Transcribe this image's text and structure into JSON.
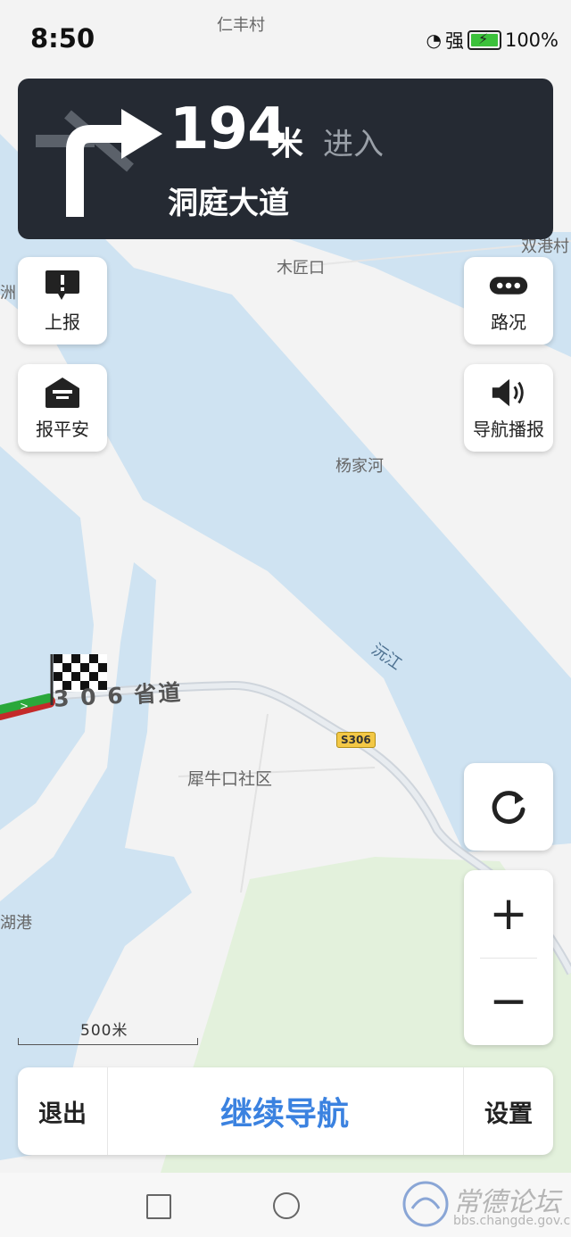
{
  "status_bar": {
    "time": "8:50",
    "signal_label": "强",
    "battery": "100%"
  },
  "nav_card": {
    "distance": "194",
    "unit": "米",
    "action": "进入",
    "road": "洞庭大道"
  },
  "left_buttons": [
    {
      "label": "上报",
      "icon": "report-icon"
    },
    {
      "label": "报平安",
      "icon": "safe-message-icon"
    }
  ],
  "right_buttons": [
    {
      "label": "路况",
      "icon": "traffic-icon"
    },
    {
      "label": "导航播报",
      "icon": "speaker-icon"
    }
  ],
  "map": {
    "labels": {
      "village_top": "仁丰村",
      "village_right": "双港村",
      "mujiang": "木匠口",
      "yangjia": "杨家河",
      "river": "沅江",
      "community": "犀牛口社区",
      "left_edge_1": "洲",
      "left_edge_2": "湖港",
      "road_shield": "S306",
      "road_name": "3 0 6 省道"
    },
    "scale": "500米"
  },
  "controls": {
    "refresh_icon": "refresh-icon",
    "zoom_in": "+",
    "zoom_out": "−"
  },
  "bottom_bar": {
    "exit": "退出",
    "continue": "继续导航",
    "settings": "设置"
  },
  "watermark": {
    "text": "常德论坛",
    "url": "bbs.changde.gov.cn"
  },
  "colors": {
    "water": "#cfe3f2",
    "land": "#f3f3f3",
    "green": "#e3f1dc",
    "card": "#252a33",
    "accent": "#3b82e0",
    "route": "#2aa83a"
  }
}
